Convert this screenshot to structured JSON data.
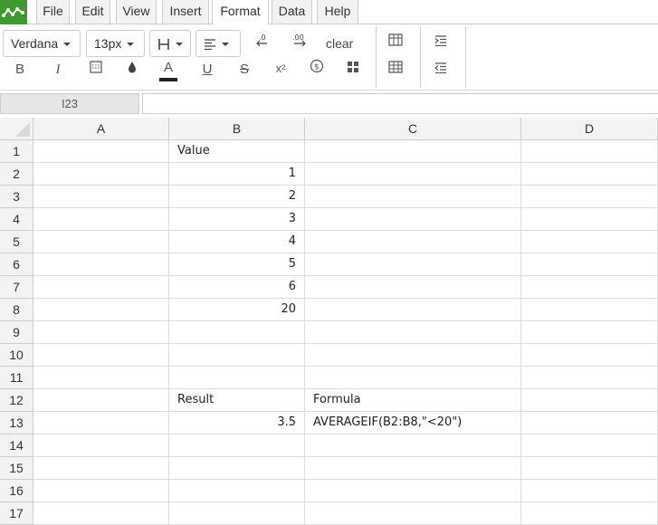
{
  "menu": {
    "items": [
      "File",
      "Edit",
      "View",
      "Insert",
      "Format",
      "Data",
      "Help"
    ],
    "active": "Format"
  },
  "toolbar": {
    "font_family": "Verdana",
    "font_size": "13px",
    "clear_label": "clear",
    "icons": [
      "heading-icon",
      "align-icon",
      "decrease-decimal-icon",
      "increase-decimal-icon",
      "bold-icon",
      "italic-icon",
      "format-icon",
      "fill-color-icon",
      "text-color-icon",
      "underline-icon",
      "strikethrough-icon",
      "superscript-icon",
      "currency-icon",
      "layout-icon",
      "borders-icon",
      "indent-icon",
      "outdent-icon"
    ],
    "bold_label": "B",
    "italic_label": "I",
    "text_color_label": "A",
    "underline_label": "U",
    "strike_label": "S",
    "superscript_label": "x²",
    "currency_label": "$"
  },
  "formula_bar": {
    "cell_ref": "I23",
    "value": ""
  },
  "sheet": {
    "columns": [
      "A",
      "B",
      "C",
      "D"
    ],
    "rows": [
      "1",
      "2",
      "3",
      "4",
      "5",
      "6",
      "7",
      "8",
      "9",
      "10",
      "11",
      "12",
      "13",
      "14",
      "15",
      "16",
      "17"
    ],
    "cells": {
      "B1": "Value",
      "B2": "1",
      "B3": "2",
      "B4": "3",
      "B5": "4",
      "B6": "5",
      "B7": "6",
      "B8": "20",
      "B12": "Result",
      "C12": "Formula",
      "B13": "3.5",
      "C13": "AVERAGEIF(B2:B8,\"<20\")"
    },
    "numeric_cells": [
      "B2",
      "B3",
      "B4",
      "B5",
      "B6",
      "B7",
      "B8",
      "B13"
    ]
  },
  "colors": {
    "logo": "#3c9a2e",
    "text_color_underline": "#222222"
  }
}
